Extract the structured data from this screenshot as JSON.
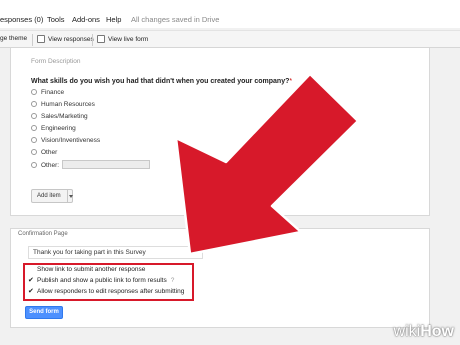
{
  "menubar": {
    "items": [
      "esponses (0)",
      "Tools",
      "Add-ons",
      "Help"
    ],
    "saved_status": "All changes saved in Drive"
  },
  "toolbar": {
    "theme_label": "ge theme",
    "view_responses_label": "View responses",
    "view_live_form_label": "View live form"
  },
  "form": {
    "description_placeholder": "Form Description",
    "question": "What skills do you wish you had that didn't when you created your company?",
    "required_marker": "*",
    "options": [
      "Finance",
      "Human Resources",
      "Sales/Marketing",
      "Engineering",
      "Vision/Inventiveness",
      "Other"
    ],
    "other_label": "Other:",
    "add_item_label": "Add item"
  },
  "confirmation": {
    "section_label": "Confirmation Page",
    "message_value": "Thank you for taking part in this Survey",
    "checkboxes": [
      {
        "label": "Show link to submit another response",
        "checked": false
      },
      {
        "label": "Publish and show a public link to form results",
        "checked": true
      },
      {
        "label": "Allow responders to edit responses after submitting",
        "checked": true
      }
    ],
    "help_mark": "?",
    "send_button_label": "Send form"
  },
  "colors": {
    "accent_red": "#d7192a",
    "button_blue": "#4d90fe"
  },
  "watermark": {
    "part1": "wiki",
    "part2": "How"
  }
}
